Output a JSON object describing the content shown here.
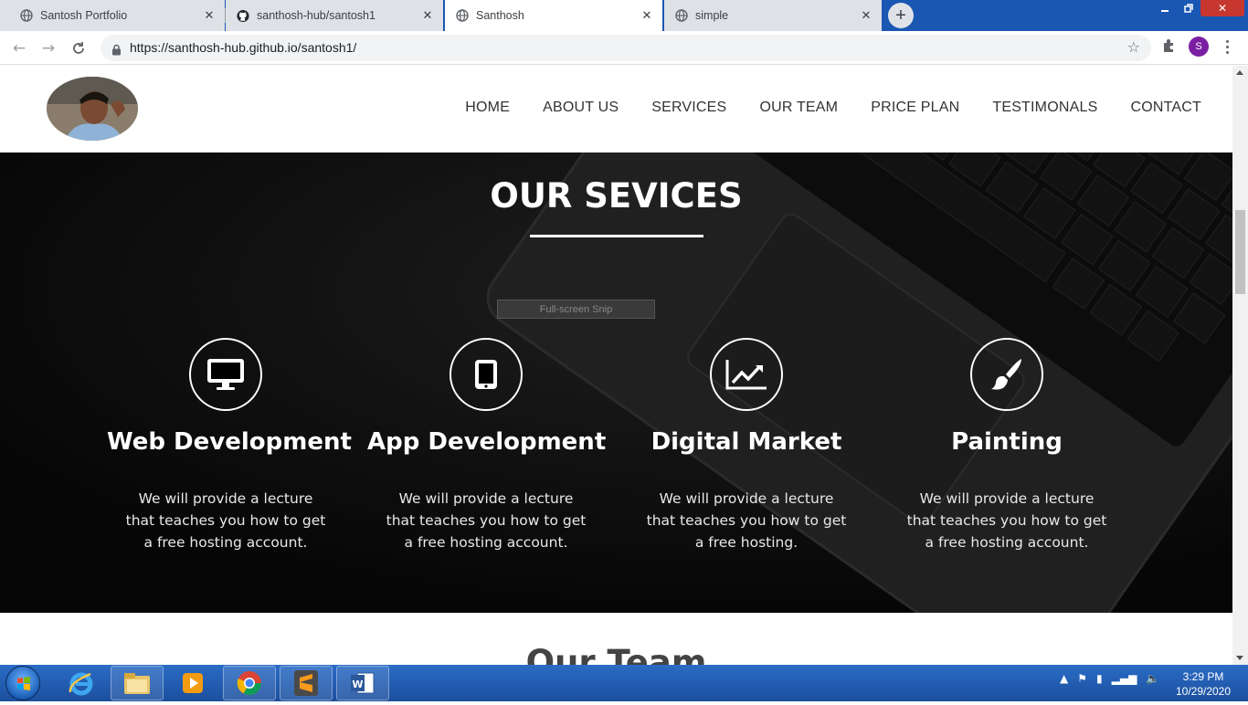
{
  "browser": {
    "tabs": [
      {
        "label": "Santosh Portfolio",
        "icon": "globe-icon",
        "active": false
      },
      {
        "label": "santhosh-hub/santosh1",
        "icon": "github-icon",
        "active": false
      },
      {
        "label": "Santhosh",
        "icon": "globe-icon",
        "active": true
      },
      {
        "label": "simple",
        "icon": "globe-icon",
        "active": false
      }
    ],
    "new_tab_label": "+",
    "url": "https://santhosh-hub.github.io/santosh1/",
    "profile_initial": "S"
  },
  "site": {
    "nav": [
      "HOME",
      "ABOUT US",
      "SERVICES",
      "OUR TEAM",
      "PRICE PLAN",
      "TESTIMONALS",
      "CONTACT"
    ],
    "services": {
      "title": "OUR SEVICES",
      "overlay_label": "Full-screen Snip",
      "items": [
        {
          "icon": "monitor-icon",
          "title": "Web Development",
          "text": "We will provide a lecture that teaches you how to get a free hosting account."
        },
        {
          "icon": "tablet-icon",
          "title": "App Development",
          "text": "We will provide a lecture that teaches you how to get a free hosting account."
        },
        {
          "icon": "chart-line-icon",
          "title": "Digital Market",
          "text": "We will provide a lecture that teaches you how to get a free hosting."
        },
        {
          "icon": "paint-brush-icon",
          "title": "Painting",
          "text": "We will provide a lecture that teaches you how to get a free hosting account."
        }
      ]
    },
    "next_section_title": "Our Team"
  },
  "taskbar": {
    "apps": [
      "internet-explorer-icon",
      "file-explorer-icon",
      "media-player-icon",
      "chrome-icon",
      "sublime-text-icon",
      "word-icon"
    ],
    "time": "3:29 PM",
    "date": "10/29/2020"
  },
  "colors": {
    "titlebar": "#1a57b3",
    "services_bg": "#0c0c0c",
    "profile": "#7b1fa2"
  }
}
